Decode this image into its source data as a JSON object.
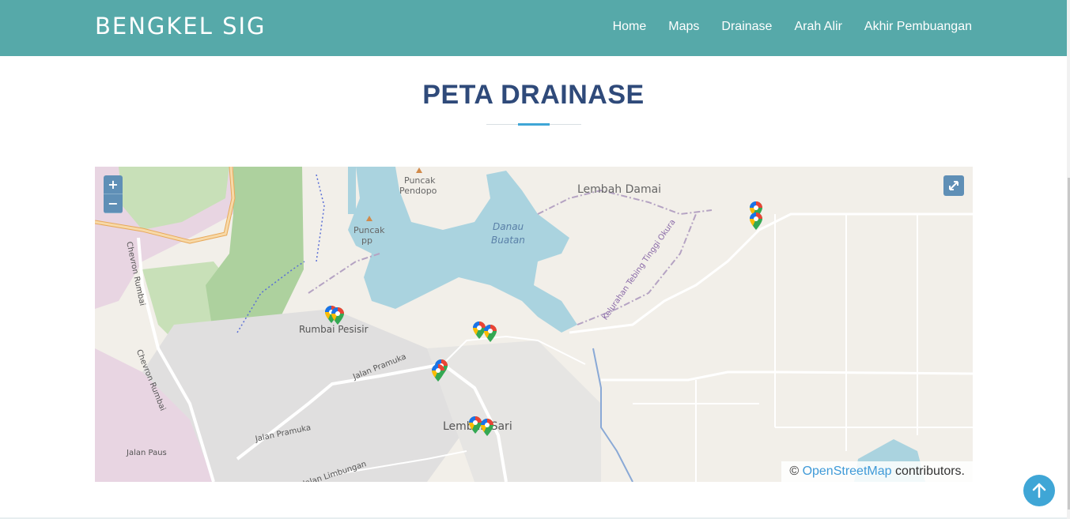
{
  "brand": "BENGKEL SIG",
  "nav": {
    "home": "Home",
    "maps": "Maps",
    "drainase": "Drainase",
    "arah_alir": "Arah Alir",
    "akhir": "Akhir Pembuangan"
  },
  "section_title": "PETA DRAINASE",
  "map": {
    "zoom_in": "+",
    "zoom_out": "−",
    "attribution_prefix": "© ",
    "attribution_link": "OpenStreetMap",
    "attribution_suffix": " contributors.",
    "labels": {
      "lembah_damai": "Lembah Damai",
      "danau": "Danau",
      "buatan": "Buatan",
      "puncak_pp": "Puncak",
      "pp": "pp",
      "puncak_pendopo": "Puncak",
      "pendopo": "Pendopo",
      "rumbai_pesisir": "Rumbai Pesisir",
      "jalan_pramuka_1": "Jalan Pramuka",
      "jalan_pramuka_2": "Jalan Pramuka",
      "lembah_sari": "Lembah Sari",
      "chevron_rumbai_1": "Chevron Rumbai",
      "chevron_rumbai_2": "Chevron Rumbai",
      "jalan_paus": "Jalan Paus",
      "jalan_limbungan": "Jalan Limbungan",
      "kelurahan": "Kelurahan Tebing Tinggi Okura"
    },
    "marker_icon": "google-maps-pin-icon",
    "colors": {
      "water": "#aad3df",
      "forest": "#add19e",
      "land": "#f2efe9",
      "residential": "#e0dfdf",
      "military": "#e8d5e2"
    }
  },
  "icons": {
    "fullscreen": "expand-icon",
    "back_to_top": "arrow-up-icon"
  }
}
